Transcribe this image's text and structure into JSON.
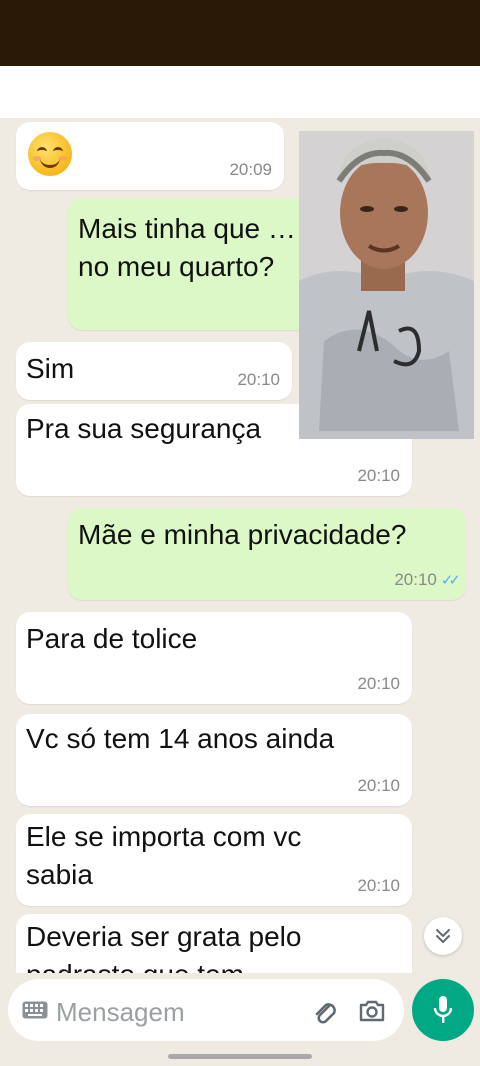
{
  "messages": [
    {
      "id": "m1",
      "direction": "in",
      "emoji": "smiling-face",
      "time": "20:09"
    },
    {
      "id": "m2",
      "direction": "out",
      "text": "Mais tinha que …\nno meu quarto?",
      "time": ""
    },
    {
      "id": "m3",
      "direction": "in",
      "text": "Sim",
      "time": "20:10"
    },
    {
      "id": "m4",
      "direction": "in",
      "text": "Pra sua segurança",
      "time": "20:10"
    },
    {
      "id": "m5",
      "direction": "out",
      "text": "Mãe e minha privacidade?",
      "time": "20:10",
      "status": "read"
    },
    {
      "id": "m6",
      "direction": "in",
      "text": "Para de tolice",
      "time": "20:10"
    },
    {
      "id": "m7",
      "direction": "in",
      "text": "Vc só tem 14 anos ainda",
      "time": "20:10"
    },
    {
      "id": "m8",
      "direction": "in",
      "text": "Ele se importa com vc\nsabia",
      "time": "20:10"
    },
    {
      "id": "m9",
      "direction": "in",
      "text": "Deveria ser grata pelo\npadrasto que tem",
      "time": ""
    }
  ],
  "composer": {
    "placeholder": "Mensagem",
    "icons": [
      "keyboard-icon",
      "attach-icon",
      "camera-icon",
      "mic-icon"
    ]
  },
  "colors": {
    "incoming_bubble": "#ffffff",
    "outgoing_bubble": "#dcf8c6",
    "read_ticks": "#4fb6ec",
    "mic_button": "#00a884",
    "chat_background": "#efeae2"
  }
}
